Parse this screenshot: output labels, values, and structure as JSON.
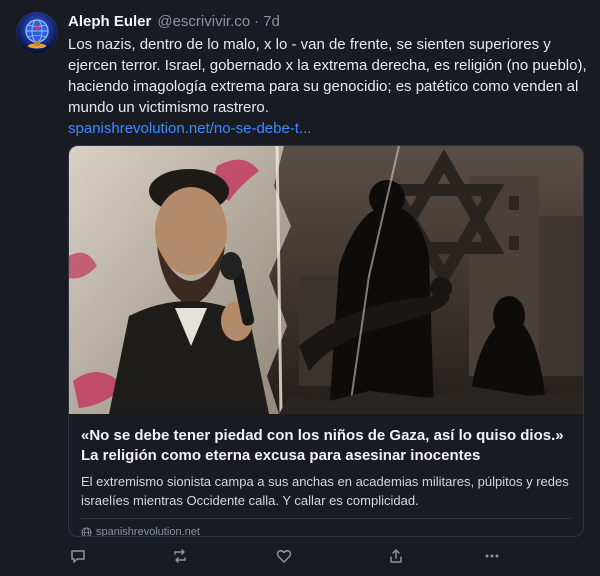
{
  "post": {
    "author": {
      "display_name": "Aleph Euler",
      "handle": "@escrivivir.co",
      "avatar_icon": "globe-avatar-icon"
    },
    "separator": "·",
    "timestamp": "7d",
    "text": "Los nazis, dentro de lo malo, x lo - van de frente, se sienten superiores y ejercen terror. Israel, gobernado x la extrema derecha, es religión (no pueblo), haciendo imagología extrema para su genocidio; es patético como venden al mundo un victimismo rastrero.",
    "link_text": "spanishrevolution.net/no-se-debe-t..."
  },
  "card": {
    "title": "«No se debe tener piedad con los niños de Gaza, así lo quiso dios.» La religión como eterna excusa para asesinar inocentes",
    "description": "El extremismo sionista campa a sus anchas en academias militares, púlpitos y redes israelíes mientras Occidente calla. Y callar es complicidad.",
    "domain": "spanishrevolution.net"
  },
  "actions": {
    "reply_icon": "reply-icon",
    "repost_icon": "repost-icon",
    "like_icon": "heart-icon",
    "share_icon": "share-icon",
    "more_icon": "more-icon"
  },
  "colors": {
    "background": "#181b22",
    "link": "#3d8bff",
    "muted": "#8a93a3",
    "border": "#2e3440"
  }
}
